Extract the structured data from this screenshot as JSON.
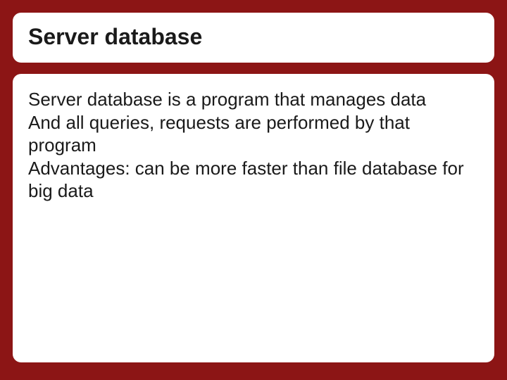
{
  "slide": {
    "title": "Server database",
    "body": {
      "line1": "Server database is a program that manages data",
      "line2": "And all queries, requests are performed by that program",
      "line3": "Advantages: can be more faster than file database for big data"
    }
  }
}
